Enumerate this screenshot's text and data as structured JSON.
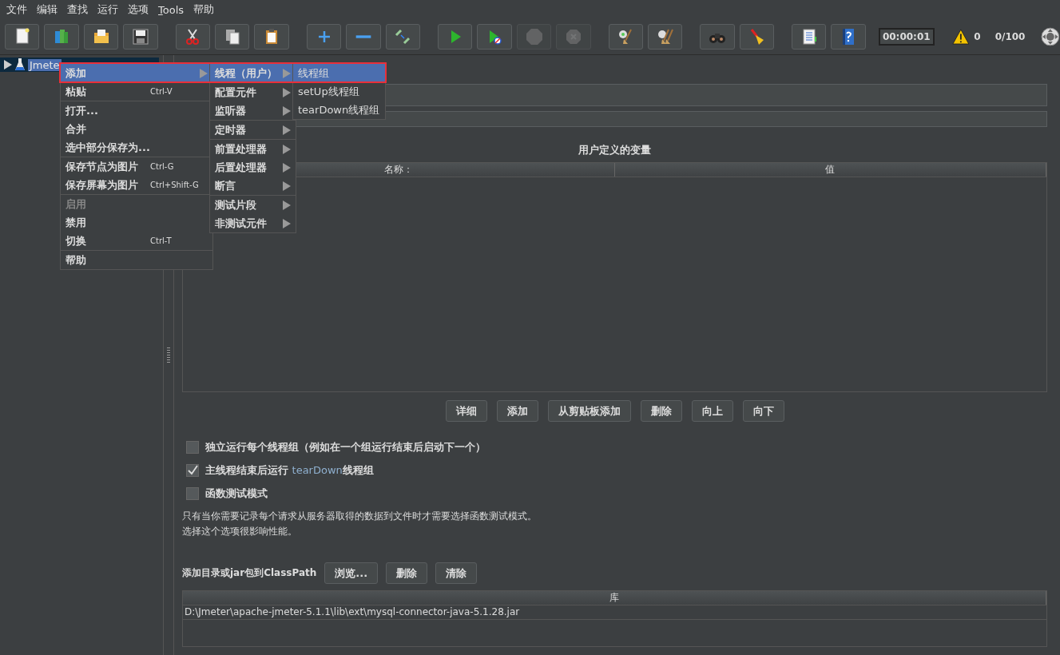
{
  "menu_bar": [
    {
      "label": "文件"
    },
    {
      "label": "编辑"
    },
    {
      "label": "查找"
    },
    {
      "label": "运行"
    },
    {
      "label": "选项"
    },
    {
      "label": "Tools",
      "mnemonic": true
    },
    {
      "label": "帮助"
    }
  ],
  "toolbar": {
    "buttons": [
      {
        "disabled": false
      },
      {
        "disabled": false
      },
      {
        "disabled": false
      },
      {
        "disabled": false
      },
      {
        "disabled": false
      },
      {
        "disabled": false
      },
      {
        "disabled": false
      },
      {
        "disabled": false
      },
      {
        "disabled": false
      },
      {
        "disabled": false
      },
      {
        "disabled": false
      },
      {
        "disabled": false
      },
      {
        "disabled": true
      },
      {
        "disabled": true
      },
      {
        "disabled": false
      },
      {
        "disabled": false
      },
      {
        "disabled": false
      },
      {
        "disabled": false
      },
      {
        "disabled": false
      },
      {
        "disabled": false
      }
    ],
    "timer": "00:00:01",
    "warnings": "0",
    "threads": "0/100"
  },
  "tree": {
    "items": [
      {
        "label": "Jmete",
        "selected": true,
        "expanded": false
      }
    ]
  },
  "context_menu": {
    "groups": [
      [
        {
          "label": "添加",
          "submenu": true,
          "selected": true,
          "disabled": false
        },
        {
          "label": "粘贴",
          "shortcut": "Ctrl-V",
          "submenu": false,
          "selected": false,
          "disabled": false
        }
      ],
      [
        {
          "label": "打开...",
          "submenu": false,
          "selected": false,
          "disabled": false
        },
        {
          "label": "合并",
          "submenu": false,
          "selected": false,
          "disabled": false
        },
        {
          "label": "选中部分保存为...",
          "submenu": false,
          "selected": false,
          "disabled": false
        }
      ],
      [
        {
          "label": "保存节点为图片",
          "shortcut": "Ctrl-G",
          "submenu": false,
          "selected": false,
          "disabled": false
        },
        {
          "label": "保存屏幕为图片",
          "shortcut": "Ctrl+Shift-G",
          "submenu": false,
          "selected": false,
          "disabled": false
        }
      ],
      [
        {
          "label": "启用",
          "submenu": false,
          "selected": false,
          "disabled": true
        },
        {
          "label": "禁用",
          "submenu": false,
          "selected": false,
          "disabled": false
        },
        {
          "label": "切换",
          "shortcut": "Ctrl-T",
          "submenu": false,
          "selected": false,
          "disabled": false
        }
      ],
      [
        {
          "label": "帮助",
          "submenu": false,
          "selected": false,
          "disabled": false
        }
      ]
    ]
  },
  "submenu": {
    "groups": [
      [
        {
          "label": "线程（用户）",
          "submenu": true,
          "selected": true
        }
      ],
      [
        {
          "label": "配置元件",
          "submenu": true,
          "selected": false
        },
        {
          "label": "监听器",
          "submenu": true,
          "selected": false
        }
      ],
      [
        {
          "label": "定时器",
          "submenu": true,
          "selected": false
        }
      ],
      [
        {
          "label": "前置处理器",
          "submenu": true,
          "selected": false
        },
        {
          "label": "后置处理器",
          "submenu": true,
          "selected": false
        },
        {
          "label": "断言",
          "submenu": true,
          "selected": false
        }
      ],
      [
        {
          "label": "测试片段",
          "submenu": true,
          "selected": false
        },
        {
          "label": "非测试元件",
          "submenu": true,
          "selected": false
        }
      ]
    ]
  },
  "thread_submenu": {
    "items": [
      {
        "label": "线程组",
        "selected": true
      },
      {
        "label": "setUp线程组",
        "selected": false
      },
      {
        "label": "tearDown线程组",
        "selected": false
      }
    ]
  },
  "variables": {
    "title": "用户定义的变量",
    "columns": [
      "名称：",
      "值"
    ],
    "buttons": [
      {
        "label": "详细"
      },
      {
        "label": "添加"
      },
      {
        "label": "从剪贴板添加"
      },
      {
        "label": "删除"
      },
      {
        "label": "向上"
      },
      {
        "label": "向下"
      }
    ]
  },
  "options": [
    {
      "label": "独立运行每个线程组（例如在一个组运行结束后启动下一个）",
      "checked": false
    },
    {
      "label": "主线程结束后运行 ",
      "highlight": "tearDown",
      "suffix": "线程组",
      "checked": true
    },
    {
      "label": "函数测试模式",
      "checked": false
    }
  ],
  "note": [
    "只有当你需要记录每个请求从服务器取得的数据到文件时才需要选择函数测试模式。",
    "选择这个选项很影响性能。"
  ],
  "classpath": {
    "label": "添加目录或jar包到ClassPath",
    "buttons": [
      {
        "label": "浏览..."
      },
      {
        "label": "删除"
      },
      {
        "label": "清除"
      }
    ],
    "column": "库",
    "rows": [
      "D:\\Jmeter\\apache-jmeter-5.1.1\\lib\\ext\\mysql-connector-java-5.1.28.jar"
    ]
  }
}
